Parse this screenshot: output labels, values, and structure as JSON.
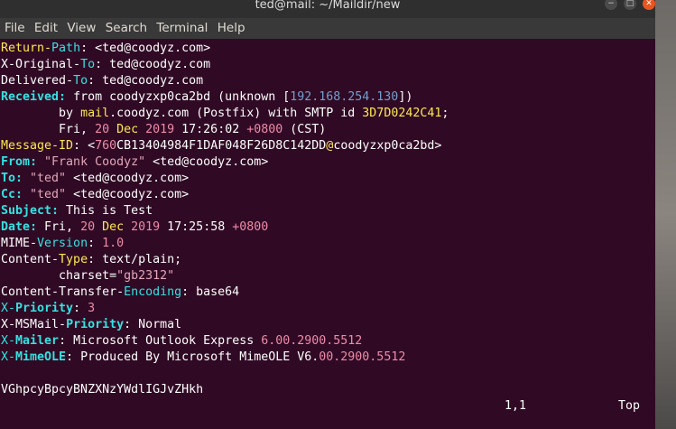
{
  "window": {
    "title": "ted@mail: ~/Maildir/new",
    "buttons": {
      "minimize": "−",
      "maximize": "□",
      "close": "✕"
    }
  },
  "menu": [
    "File",
    "Edit",
    "View",
    "Search",
    "Terminal",
    "Help"
  ],
  "headers": {
    "return_path": {
      "key_a": "Return-",
      "key_b": "Path",
      "sep": ": ",
      "value": "<ted@coodyz.com>"
    },
    "x_original_to": {
      "key_a": "X-Original-",
      "key_b": "To",
      "sep": ": ",
      "value": "ted@coodyz.com"
    },
    "delivered_to": {
      "key_a": "Delivered-",
      "key_b": "To",
      "sep": ": ",
      "value": "ted@coodyz.com"
    },
    "received": {
      "key": "Received:",
      "line1_a": " from coodyzxp0ca2bd (unknown [",
      "line1_ip": "192.168.254.130",
      "line1_b": "])",
      "line2_a": "        by ",
      "line2_host": "mail",
      "line2_b": ".coodyz.com (Postfix) with SMTP id ",
      "line2_id": "3D7D0242C41",
      "line2_c": ";",
      "line3_a": "        Fri, ",
      "line3_day": "20",
      "line3_mon": " Dec ",
      "line3_year": "2019",
      "line3_time": " 17:26:02 ",
      "line3_tz": "+0800",
      "line3_b": " (CST)"
    },
    "message_id": {
      "key": "Message-ID",
      "sep": ": <",
      "id_num": "760",
      "id_rest": "CB13404984F1DAF048F26D8C142DD",
      "at": "@",
      "domain": "coodyzxp0ca2bd",
      "end": ">"
    },
    "from": {
      "key": "From:",
      "name": " \"Frank Coodyz\"",
      "addr": " <ted@coodyz.com>"
    },
    "to": {
      "key": "To:",
      "name": " \"ted\"",
      "addr": " <ted@coodyz.com>"
    },
    "cc": {
      "key": "Cc:",
      "name": " \"ted\"",
      "addr": " <ted@coodyz.com>"
    },
    "subject": {
      "key": "Subject:",
      "value": " This is Test"
    },
    "date": {
      "key": "Date:",
      "a": " Fri, ",
      "day": "20",
      "mon": " Dec ",
      "year": "2019",
      "time": " 17:25:58 ",
      "tz": "+0800"
    },
    "mime_version": {
      "key_a": "MIME-",
      "key_b": "Version",
      "sep": ": ",
      "value": "1.0"
    },
    "content_type": {
      "key_a": "Content-",
      "key_b": "Type",
      "sep": ": ",
      "value": "text/plain;"
    },
    "charset": {
      "a": "        charset=",
      "value": "\"gb2312\""
    },
    "cte": {
      "key_a": "Content-Transfer-",
      "key_b": "Encoding",
      "sep": ": ",
      "value": "base64"
    },
    "x_priority": {
      "key_a": "X-",
      "key_b": "Priority",
      "sep": ": ",
      "value": "3"
    },
    "x_msmail": {
      "key_a": "X-MSMail-",
      "key_b": "Priority",
      "sep": ": ",
      "value": "Normal"
    },
    "x_mailer": {
      "key_a": "X-",
      "key_b": "Mailer",
      "sep": ": ",
      "value_a": "Microsoft Outlook Express ",
      "value_b": "6.00.2900.5512"
    },
    "x_mimeole": {
      "key_a": "X-",
      "key_b": "MimeOLE",
      "sep": ": ",
      "value_a": "Produced By Microsoft MimeOLE V6.",
      "value_b": "00.2900.5512"
    }
  },
  "body_text": "VGhpcyBpcyBNZXNzYWdlIGJvZHkh",
  "status": {
    "position": "1,1",
    "scroll": "Top"
  }
}
